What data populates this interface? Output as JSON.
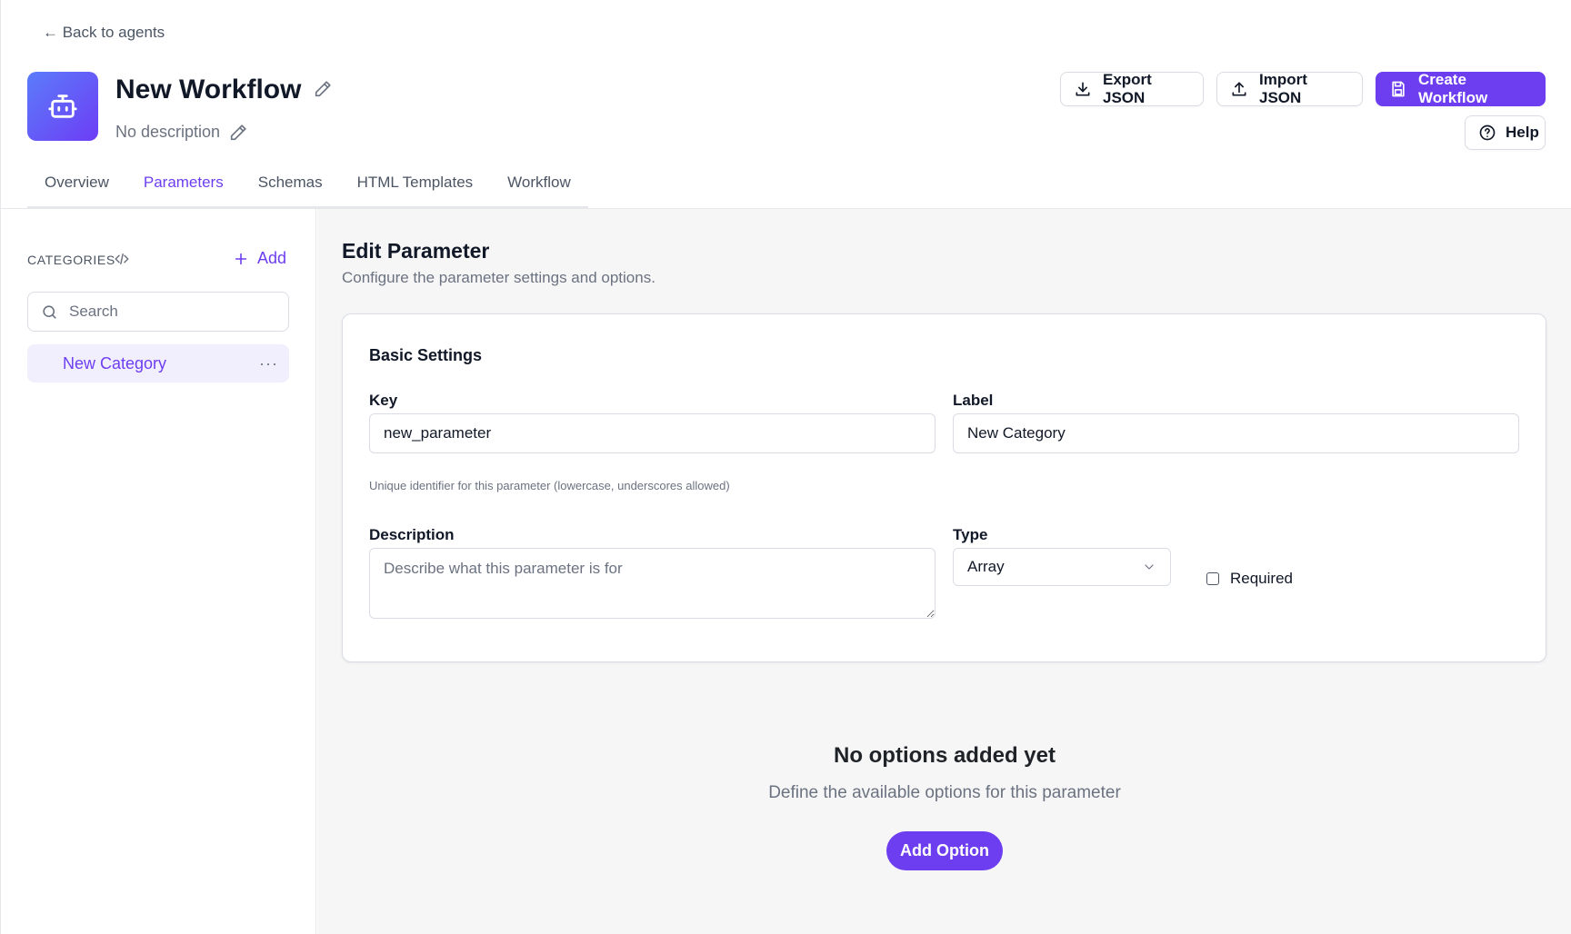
{
  "header": {
    "back_link": "← Back to agents",
    "title": "New Workflow",
    "description": "No description",
    "actions": {
      "export": "Export JSON",
      "import": "Import JSON",
      "create": "Create Workflow",
      "help": "Help"
    }
  },
  "tabs": [
    {
      "label": "Overview",
      "active": false
    },
    {
      "label": "Parameters",
      "active": true
    },
    {
      "label": "Schemas",
      "active": false
    },
    {
      "label": "HTML Templates",
      "active": false
    },
    {
      "label": "Workflow",
      "active": false
    }
  ],
  "sidebar": {
    "categories_label": "CATEGORIES",
    "add_label": "Add",
    "search_placeholder": "Search",
    "items": [
      {
        "label": "New Category",
        "more": "···",
        "selected": true
      }
    ]
  },
  "editor": {
    "title": "Edit Parameter",
    "subtitle": "Configure the parameter settings and options.",
    "section_title": "Basic Settings",
    "key": {
      "label": "Key",
      "value": "new_parameter",
      "hint": "Unique identifier for this parameter (lowercase, underscores allowed)"
    },
    "label_field": {
      "label": "Label",
      "value": "New Category"
    },
    "description": {
      "label": "Description",
      "placeholder": "Describe what this parameter is for"
    },
    "type": {
      "label": "Type",
      "value": "Array"
    },
    "required": {
      "label": "Required",
      "checked": false
    }
  },
  "options": {
    "empty_title": "No options added yet",
    "empty_subtitle": "Define the available options for this parameter",
    "add_button": "Add Option"
  },
  "colors": {
    "accent": "#6d3ef0",
    "avatar_gradient_start": "#5b7cfa",
    "avatar_gradient_end": "#6d3df5",
    "selected_bg": "#f1eefe",
    "main_bg": "#f6f6f7"
  }
}
